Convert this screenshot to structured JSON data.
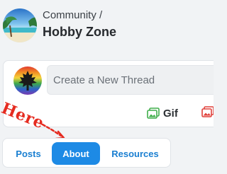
{
  "header": {
    "breadcrumb": "Community /",
    "title": "Hobby Zone"
  },
  "composer": {
    "placeholder": "Create a New Thread",
    "gif_label": "Gif"
  },
  "annotation": {
    "text": "Here",
    "color": "#e52b20"
  },
  "tabs": [
    {
      "label": "Posts",
      "active": false
    },
    {
      "label": "About",
      "active": true
    },
    {
      "label": "Resources",
      "active": false
    }
  ],
  "colors": {
    "accent": "#1d8ae5",
    "link": "#1a7fd1",
    "gif_icon": "#3fae4a",
    "image_icon": "#e0413b"
  },
  "icons": {
    "community_avatar": "beach-landscape",
    "user_avatar": "maple-leaf-rainbow",
    "gif": "image-icon",
    "image": "image-icon"
  }
}
